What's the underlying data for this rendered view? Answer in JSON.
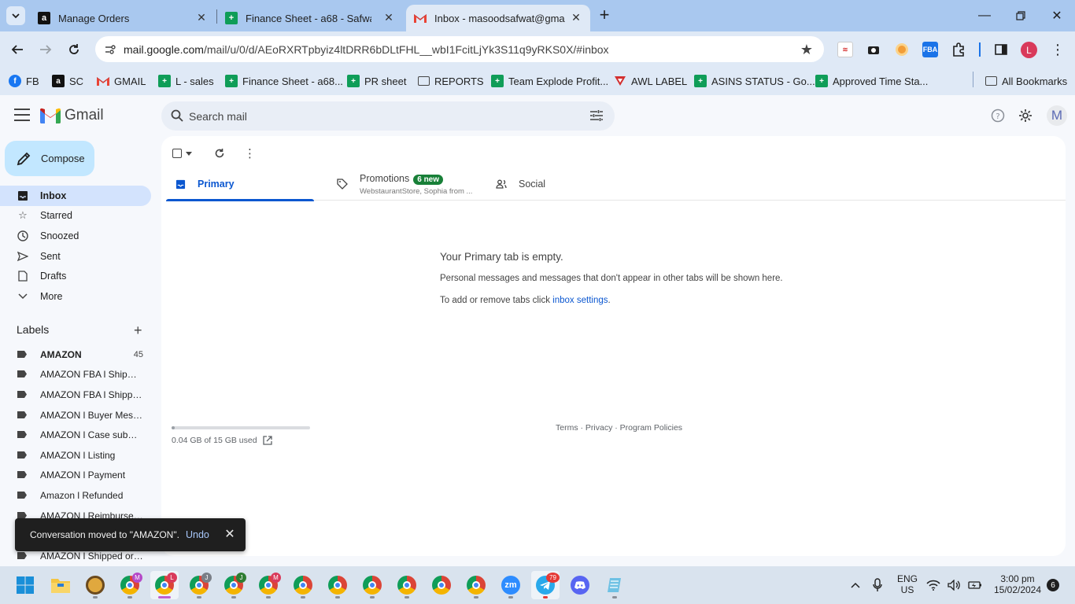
{
  "browser": {
    "tabs": [
      {
        "title": "Manage Orders",
        "icon": "amazon-icon"
      },
      {
        "title": "Finance Sheet - a68 - Safwat (S…",
        "icon": "sheets-icon"
      },
      {
        "title": "Inbox - masoodsafwat@gmail.c…",
        "icon": "gmail-icon",
        "active": true
      }
    ],
    "url_host": "mail.google.com",
    "url_path": "/mail/u/0/d/AEoRXRTpbyiz4ltDRR6bDLtFHL__wbI1FcitLjYk3S11q9yRKS0X/#inbox",
    "profile_initial": "L",
    "bookmarks": [
      {
        "label": "FB",
        "icon": "facebook-icon"
      },
      {
        "label": "SC",
        "icon": "amazon-icon"
      },
      {
        "label": "GMAIL",
        "icon": "gmail-icon"
      },
      {
        "label": "L - sales",
        "icon": "sheets-icon"
      },
      {
        "label": "Finance Sheet - a68...",
        "icon": "sheets-icon"
      },
      {
        "label": "PR sheet",
        "icon": "sheets-icon"
      },
      {
        "label": "REPORTS",
        "icon": "folder-icon"
      },
      {
        "label": "Team Explode Profit...",
        "icon": "sheets-icon"
      },
      {
        "label": "AWL LABEL",
        "icon": "awl-icon"
      },
      {
        "label": "ASINS STATUS - Go...",
        "icon": "sheets-icon"
      },
      {
        "label": "Approved Time Sta...",
        "icon": "sheets-icon"
      },
      {
        "label": "All Bookmarks",
        "icon": "folder-icon"
      }
    ]
  },
  "gmail": {
    "product_name": "Gmail",
    "search_placeholder": "Search mail",
    "account_initial": "M",
    "compose_label": "Compose",
    "nav": [
      {
        "label": "Inbox",
        "icon": "inbox-icon",
        "active": true
      },
      {
        "label": "Starred",
        "icon": "star-icon"
      },
      {
        "label": "Snoozed",
        "icon": "clock-icon"
      },
      {
        "label": "Sent",
        "icon": "send-icon"
      },
      {
        "label": "Drafts",
        "icon": "draft-icon"
      },
      {
        "label": "More",
        "icon": "chevron-down-icon"
      }
    ],
    "labels_heading": "Labels",
    "labels": [
      {
        "name": "AMAZON",
        "count": "45",
        "bold": true
      },
      {
        "name": "AMAZON FBA l Shipment …"
      },
      {
        "name": "AMAZON FBA l Shipped …"
      },
      {
        "name": "AMAZON l Buyer Messa…"
      },
      {
        "name": "AMAZON l Case submitt…"
      },
      {
        "name": "AMAZON l Listing"
      },
      {
        "name": "AMAZON l Payment"
      },
      {
        "name": "Amazon l Refunded"
      },
      {
        "name": "AMAZON l Reimbursem…"
      },
      {
        "name": "AMAZON l Shipped order"
      }
    ],
    "tabs": {
      "primary": "Primary",
      "promotions": "Promotions",
      "promotions_badge": "6 new",
      "promotions_preview": "WebstaurantStore, Sophia from ...",
      "social": "Social"
    },
    "empty": {
      "title": "Your Primary tab is empty.",
      "subtitle": "Personal messages and messages that don't appear in other tabs will be shown here.",
      "add_prefix": "To add or remove tabs click ",
      "add_link": "inbox settings",
      "add_suffix": "."
    },
    "storage": {
      "text": "0.04 GB of 15 GB used",
      "used_fraction": 0.003
    },
    "footer": "Terms · Privacy · Program Policies",
    "snackbar": {
      "message": "Conversation moved to \"AMAZON\".",
      "undo": "Undo"
    }
  },
  "taskbar": {
    "language": "ENG",
    "region": "US",
    "time": "3:00 pm",
    "date": "15/02/2024",
    "notification_count": "6",
    "telegram_badge": "79"
  },
  "colors": {
    "accent": "#0b57d0",
    "compose_bg": "#c2e7ff",
    "active_nav": "#d3e3fd",
    "badge_green": "#188038"
  }
}
